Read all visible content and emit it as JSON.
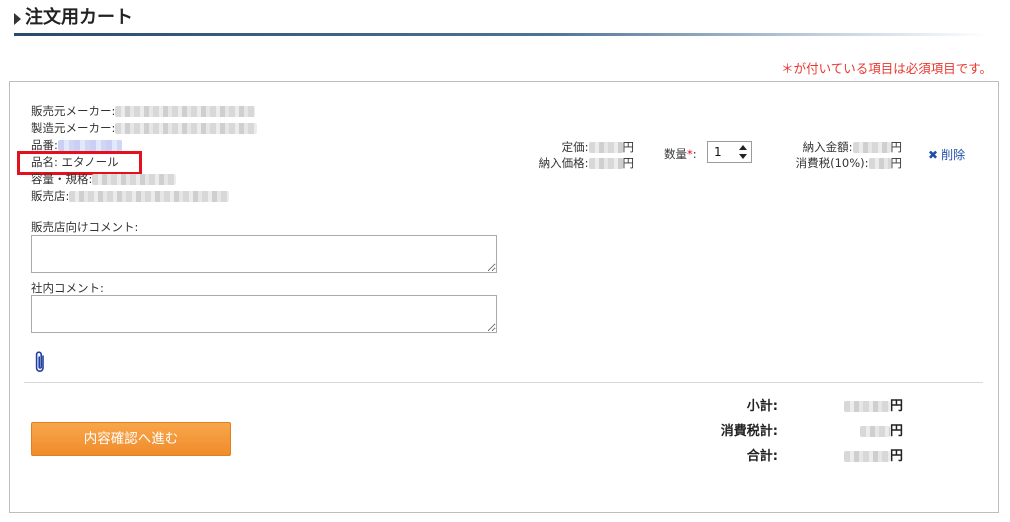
{
  "heading": {
    "title": "注文用カート"
  },
  "required_note": "＊が付いている項目は必須項目です。",
  "item": {
    "seller_maker_label": "販売元メーカー:",
    "manufacturer_label": "製造元メーカー:",
    "part_no_label": "品番:",
    "name_label": "品名:",
    "name_value": "エタノール",
    "capacity_label": "容量・規格:",
    "store_label": "販売店:"
  },
  "comments": {
    "store_comment_label": "販売店向けコメント:",
    "internal_comment_label": "社内コメント:"
  },
  "pricing": {
    "list_price_label": "定価:",
    "delivery_price_label": "納入価格:",
    "yen": "円",
    "quantity_label": "数量",
    "required_star": "*",
    "quantity_value": "1",
    "delivery_amount_label": "納入金額:",
    "tax_label": "消費税(10%):"
  },
  "delete": {
    "icon": "✖",
    "label": "削除"
  },
  "totals": {
    "subtotal_label": "小計:",
    "tax_total_label": "消費税計:",
    "grand_total_label": "合計:",
    "yen": "円"
  },
  "actions": {
    "proceed_label": "内容確認へ進む"
  },
  "icons": {
    "attachment": "paperclip-icon"
  },
  "colors": {
    "accent_orange": "#f08c2a",
    "required_red": "#e8362c",
    "link_blue": "#1f4ea8",
    "highlight_red": "#e3101e"
  }
}
